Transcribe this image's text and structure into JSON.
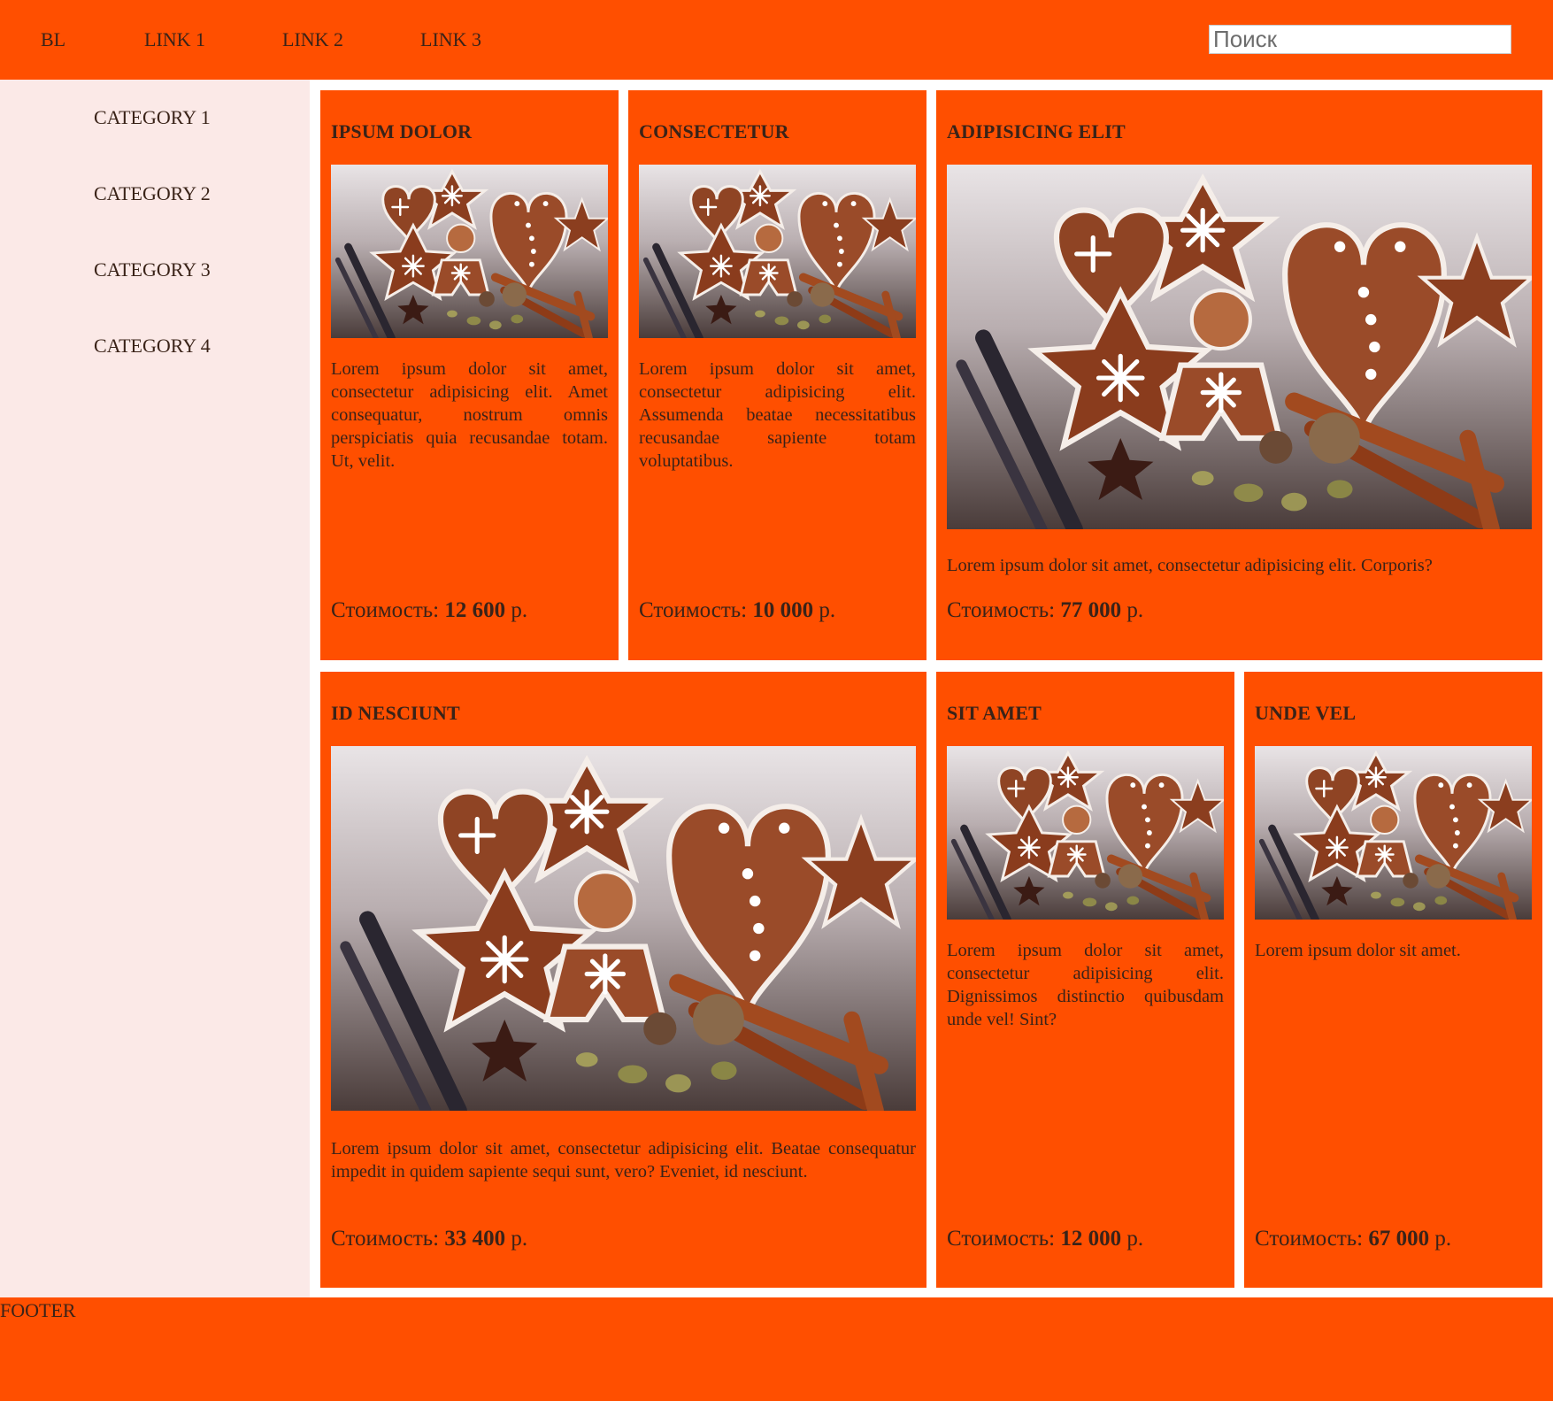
{
  "header": {
    "logo": "BL",
    "links": [
      "LINK 1",
      "LINK 2",
      "LINK 3"
    ],
    "search": {
      "placeholder": "Поиск",
      "value": ""
    }
  },
  "sidebar": {
    "categories": [
      "CATEGORY 1",
      "CATEGORY 2",
      "CATEGORY 3",
      "CATEGORY 4"
    ]
  },
  "price_label": "Стоимость:",
  "currency": "р.",
  "products": [
    {
      "title": "IPSUM DOLOR",
      "description": "Lorem ipsum dolor sit amet, consectetur adipisicing elit. Amet consequatur, nostrum omnis perspiciatis quia recusandae totam. Ut, velit.",
      "price": "12 600"
    },
    {
      "title": "CONSECTETUR",
      "description": "Lorem ipsum dolor sit amet, consectetur adipisicing elit. Assumenda beatae necessitatibus recusandae sapiente totam voluptatibus.",
      "price": "10 000"
    },
    {
      "title": "ADIPISICING ELIT",
      "description": "Lorem ipsum dolor sit amet, consectetur adipisicing elit. Corporis?",
      "price": "77 000"
    },
    {
      "title": "ID NESCIUNT",
      "description": "Lorem ipsum dolor sit amet, consectetur adipisicing elit. Beatae consequatur impedit in quidem sapiente sequi sunt, vero? Eveniet, id nesciunt.",
      "price": "33 400"
    },
    {
      "title": "SIT AMET",
      "description": "Lorem ipsum dolor sit amet, consectetur adipisicing elit. Dignissimos distinctio quibusdam unde vel! Sint?",
      "price": "12 000"
    },
    {
      "title": "UNDE VEL",
      "description": "Lorem ipsum dolor sit amet.",
      "price": "67 000"
    }
  ],
  "footer": {
    "text": "FOOTER"
  },
  "colors": {
    "accent": "#ff4f00",
    "sidebar_bg": "#fbe9e7",
    "text": "#3a2318"
  }
}
